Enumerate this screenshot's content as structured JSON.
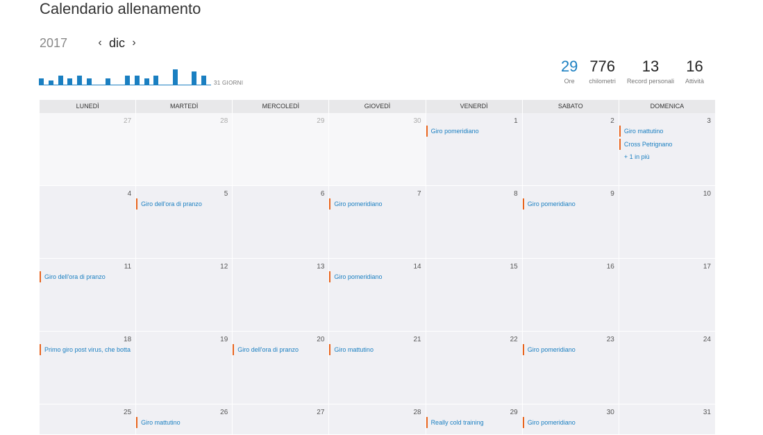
{
  "title": "Calendario allenamento",
  "nav": {
    "year": "2017",
    "prev": "‹",
    "month": "dic",
    "next": "›"
  },
  "histogram": {
    "label": "31 GIORNI",
    "values": [
      3,
      2,
      4,
      3,
      4,
      3,
      0,
      3,
      0,
      4,
      4,
      3,
      4,
      0,
      7,
      0,
      6,
      4
    ]
  },
  "stats": [
    {
      "value": "29",
      "label": "Ore"
    },
    {
      "value": "776",
      "label": "chilometri"
    },
    {
      "value": "13",
      "label": "Record personali"
    },
    {
      "value": "16",
      "label": "Attività"
    }
  ],
  "weekdays": [
    "LUNEDÌ",
    "MARTEDÌ",
    "MERCOLEDÌ",
    "GIOVEDÌ",
    "VENERDÌ",
    "SABATO",
    "DOMENICA"
  ],
  "weeks": [
    [
      {
        "d": "27",
        "other": true,
        "acts": []
      },
      {
        "d": "28",
        "other": true,
        "acts": []
      },
      {
        "d": "29",
        "other": true,
        "acts": []
      },
      {
        "d": "30",
        "other": true,
        "acts": []
      },
      {
        "d": "1",
        "acts": [
          "Giro pomeridiano"
        ]
      },
      {
        "d": "2",
        "acts": []
      },
      {
        "d": "3",
        "acts": [
          "Giro mattutino",
          "Cross Petrignano"
        ],
        "more": "+ 1 in più"
      }
    ],
    [
      {
        "d": "4",
        "acts": []
      },
      {
        "d": "5",
        "acts": [
          "Giro dell'ora di pranzo"
        ]
      },
      {
        "d": "6",
        "acts": []
      },
      {
        "d": "7",
        "acts": [
          "Giro pomeridiano"
        ]
      },
      {
        "d": "8",
        "acts": []
      },
      {
        "d": "9",
        "acts": [
          "Giro pomeridiano"
        ]
      },
      {
        "d": "10",
        "acts": []
      }
    ],
    [
      {
        "d": "11",
        "acts": [
          "Giro dell'ora di pranzo"
        ]
      },
      {
        "d": "12",
        "acts": []
      },
      {
        "d": "13",
        "acts": []
      },
      {
        "d": "14",
        "acts": [
          "Giro pomeridiano"
        ]
      },
      {
        "d": "15",
        "acts": []
      },
      {
        "d": "16",
        "acts": []
      },
      {
        "d": "17",
        "acts": []
      }
    ],
    [
      {
        "d": "18",
        "acts": [
          "Primo giro post virus, che botta"
        ]
      },
      {
        "d": "19",
        "acts": []
      },
      {
        "d": "20",
        "acts": [
          "Giro dell'ora di pranzo"
        ]
      },
      {
        "d": "21",
        "acts": [
          "Giro mattutino"
        ]
      },
      {
        "d": "22",
        "acts": []
      },
      {
        "d": "23",
        "acts": [
          "Giro pomeridiano"
        ]
      },
      {
        "d": "24",
        "acts": []
      }
    ],
    [
      {
        "d": "25",
        "acts": []
      },
      {
        "d": "26",
        "acts": [
          "Giro mattutino"
        ]
      },
      {
        "d": "27",
        "acts": []
      },
      {
        "d": "28",
        "acts": []
      },
      {
        "d": "29",
        "acts": [
          "Really cold training"
        ]
      },
      {
        "d": "30",
        "acts": [
          "Giro pomeridiano"
        ]
      },
      {
        "d": "31",
        "acts": []
      }
    ]
  ]
}
